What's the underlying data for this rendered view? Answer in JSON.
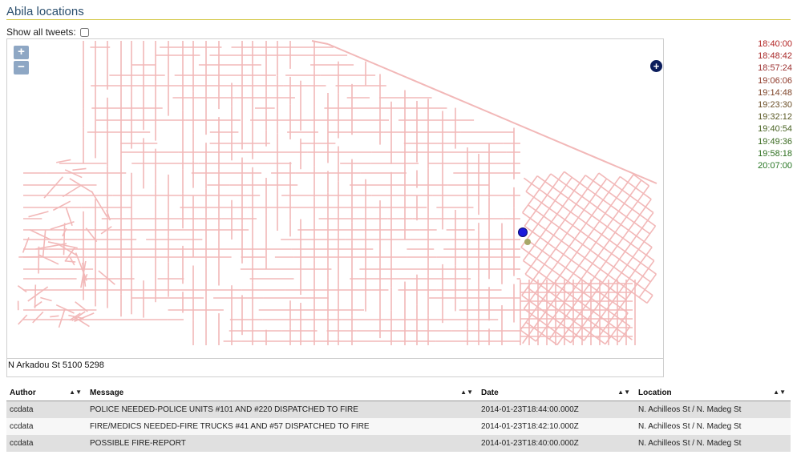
{
  "page": {
    "title": "Abila locations",
    "show_all_label": "Show all tweets:",
    "address": "N Arkadou St 5100 5298"
  },
  "map": {
    "zoom_in": "+",
    "zoom_out": "−",
    "expand": "+",
    "street_color": "#f2b8b8",
    "marker_primary_color": "#1a1adb",
    "marker_secondary_color": "#a8a868"
  },
  "times": [
    {
      "label": "18:40:00",
      "color": "#b22222"
    },
    {
      "label": "18:48:42",
      "color": "#a82828"
    },
    {
      "label": "18:57:24",
      "color": "#9c3030"
    },
    {
      "label": "19:06:06",
      "color": "#8f3a2a"
    },
    {
      "label": "19:14:48",
      "color": "#7e4428"
    },
    {
      "label": "19:23:30",
      "color": "#6b4e26"
    },
    {
      "label": "19:32:12",
      "color": "#5a5824"
    },
    {
      "label": "19:40:54",
      "color": "#486222"
    },
    {
      "label": "19:49:36",
      "color": "#3a6a20"
    },
    {
      "label": "19:58:18",
      "color": "#2e7020"
    },
    {
      "label": "20:07:00",
      "color": "#247420"
    }
  ],
  "table": {
    "headers": [
      "Author",
      "Message",
      "Date",
      "Location"
    ],
    "rows": [
      {
        "author": "ccdata",
        "message": "POLICE NEEDED-POLICE UNITS #101 AND #220 DISPATCHED TO FIRE",
        "date": "2014-01-23T18:44:00.000Z",
        "location": "N. Achilleos St / N. Madeg St"
      },
      {
        "author": "ccdata",
        "message": "FIRE/MEDICS NEEDED-FIRE TRUCKS #41 AND #57 DISPATCHED TO FIRE",
        "date": "2014-01-23T18:42:10.000Z",
        "location": "N. Achilleos St / N. Madeg St"
      },
      {
        "author": "ccdata",
        "message": "POSSIBLE FIRE-REPORT",
        "date": "2014-01-23T18:40:00.000Z",
        "location": "N. Achilleos St / N. Madeg St"
      }
    ]
  }
}
